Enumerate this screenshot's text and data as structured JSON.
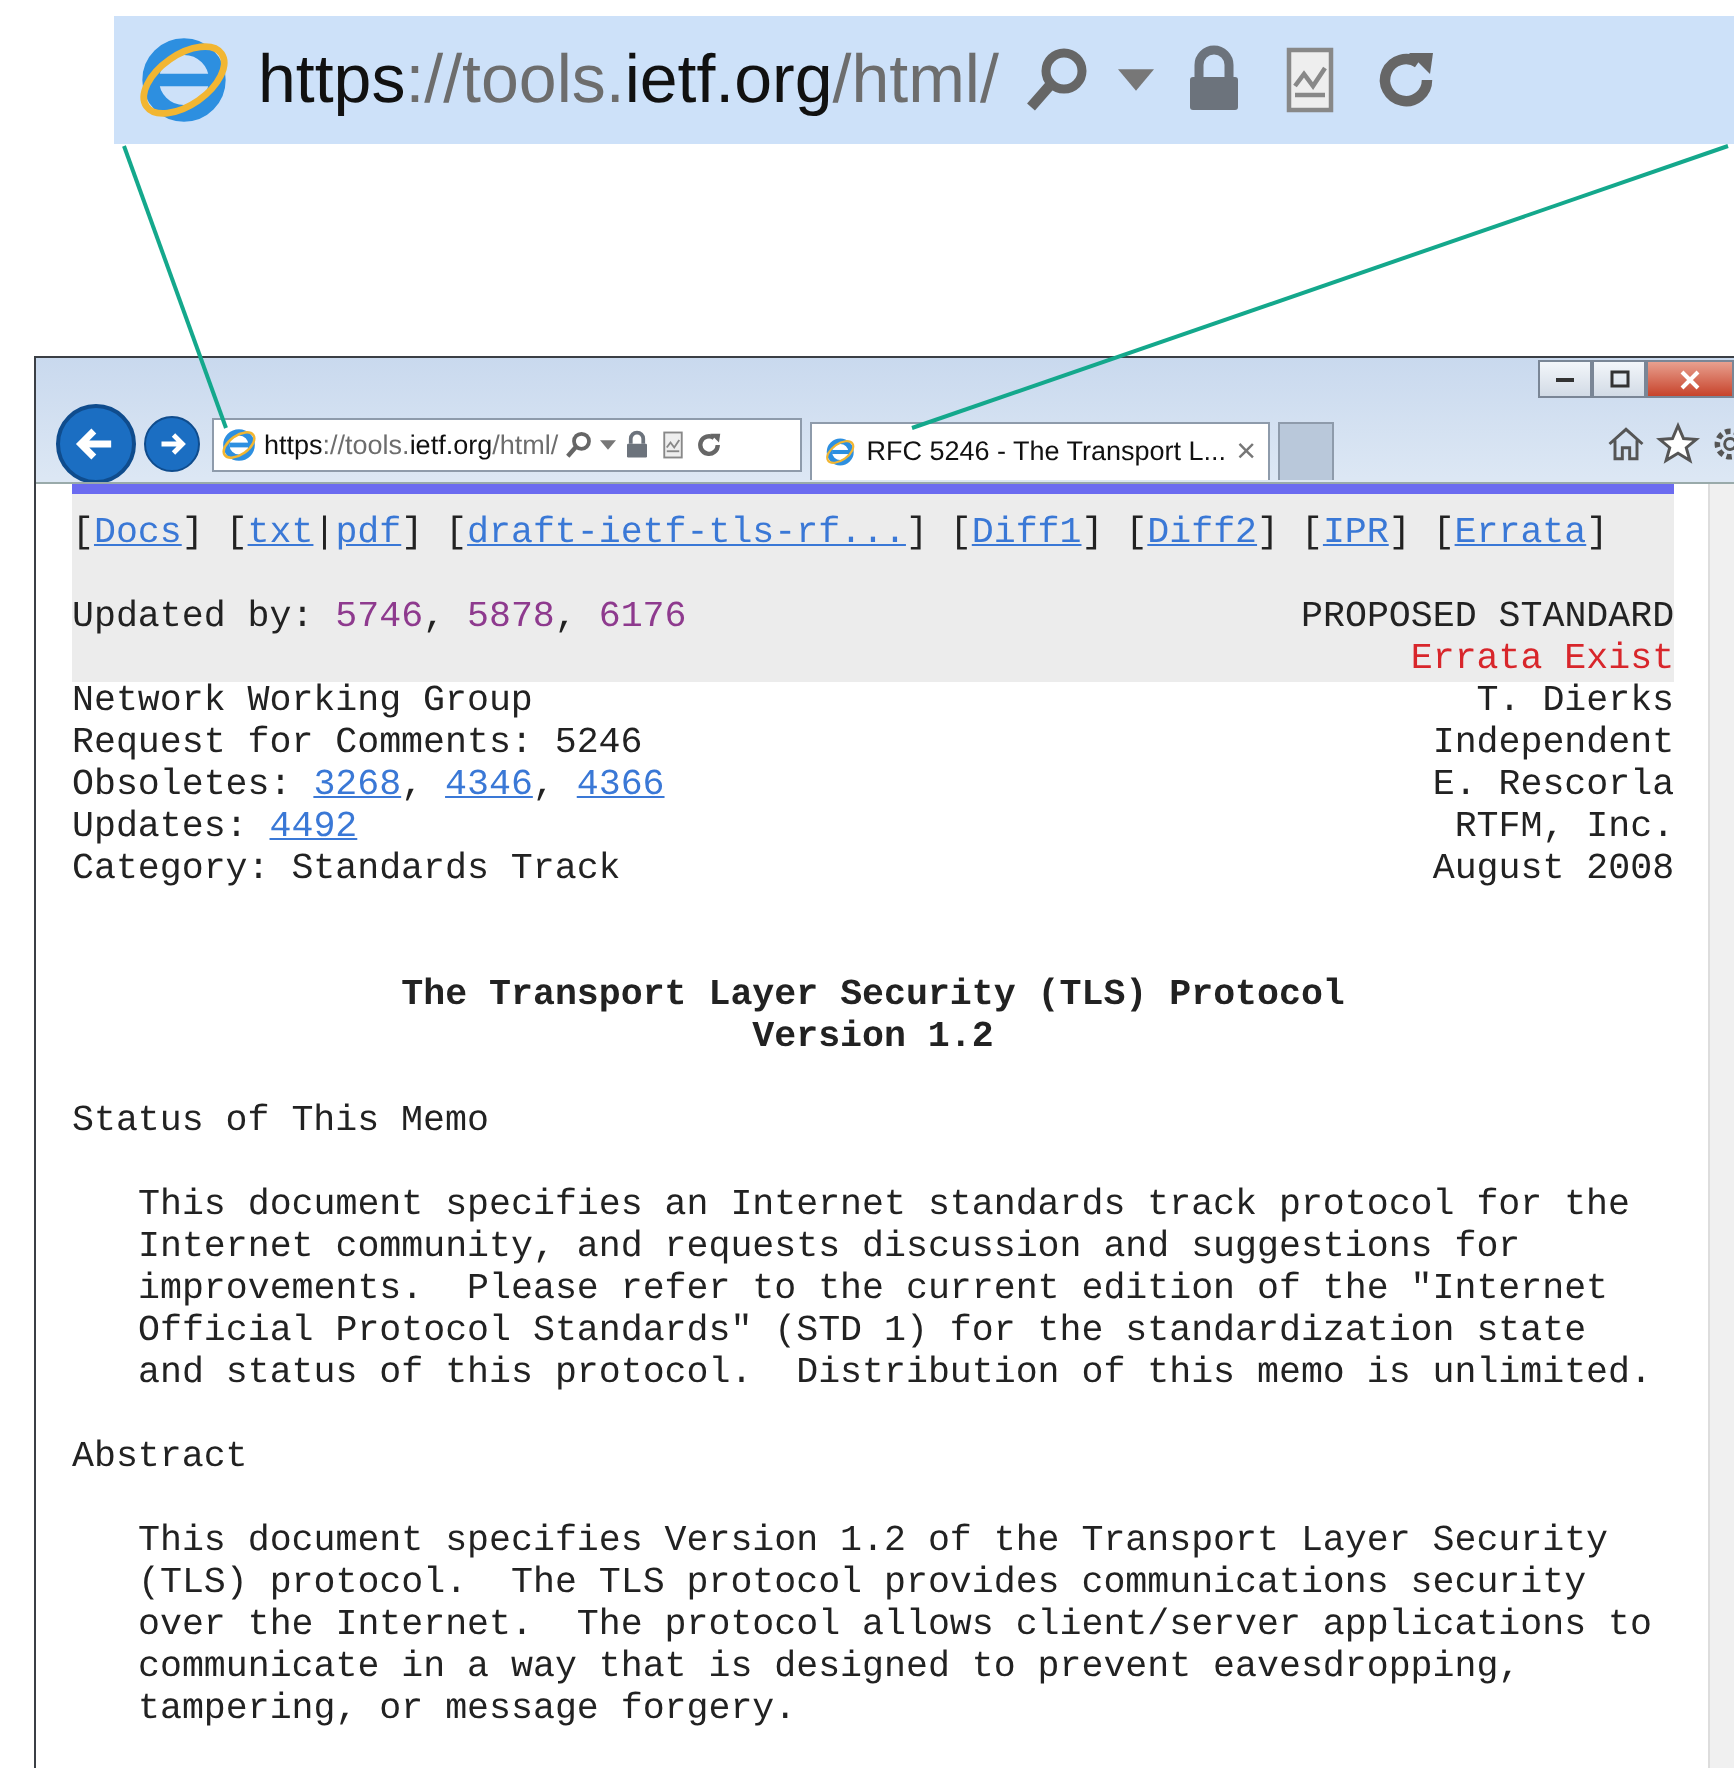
{
  "callout": {
    "url": [
      {
        "text": "https",
        "strong": true
      },
      {
        "text": "://tools.",
        "strong": false
      },
      {
        "text": "ietf.org",
        "strong": true
      },
      {
        "text": "/html/",
        "strong": false
      }
    ]
  },
  "browser": {
    "url": [
      {
        "text": "https",
        "strong": true
      },
      {
        "text": "://tools.",
        "strong": false
      },
      {
        "text": "ietf.org",
        "strong": true
      },
      {
        "text": "/html/",
        "strong": false
      }
    ],
    "tabs": [
      {
        "title": "RFC 5246 - The Transport L...",
        "close": "×",
        "selected": true
      },
      {
        "selected": false
      }
    ]
  },
  "doc": {
    "nav": [
      {
        "text": "[",
        "link": false
      },
      {
        "text": "Docs",
        "link": true
      },
      {
        "text": "] [",
        "link": false
      },
      {
        "text": "txt",
        "link": true
      },
      {
        "text": "|",
        "link": false
      },
      {
        "text": "pdf",
        "link": true
      },
      {
        "text": "] [",
        "link": false
      },
      {
        "text": "draft-ietf-tls-rf...",
        "link": true
      },
      {
        "text": "] [",
        "link": false
      },
      {
        "text": "Diff1",
        "link": true
      },
      {
        "text": "] [",
        "link": false
      },
      {
        "text": "Diff2",
        "link": true
      },
      {
        "text": "] [",
        "link": false
      },
      {
        "text": "IPR",
        "link": true
      },
      {
        "text": "] [",
        "link": false
      },
      {
        "text": "Errata",
        "link": true
      },
      {
        "text": "]",
        "link": false
      }
    ],
    "updated_by": {
      "line": [
        {
          "text": "Updated by: ",
          "link": false
        },
        {
          "text": "5746",
          "link": true
        },
        {
          "text": ", ",
          "link": false
        },
        {
          "text": "5878",
          "link": true
        },
        {
          "text": ", ",
          "link": false
        },
        {
          "text": "6176",
          "link": true
        }
      ],
      "status": "PROPOSED STANDARD",
      "errata": "Errata Exist"
    },
    "header": [
      {
        "left": [
          {
            "text": "Network Working Group",
            "link": false
          }
        ],
        "right": "T. Dierks"
      },
      {
        "left": [
          {
            "text": "Request for Comments: 5246",
            "link": false
          }
        ],
        "right": "Independent"
      },
      {
        "left": [
          {
            "text": "Obsoletes: ",
            "link": false
          },
          {
            "text": "3268",
            "link": true
          },
          {
            "text": ", ",
            "link": false
          },
          {
            "text": "4346",
            "link": true
          },
          {
            "text": ", ",
            "link": false
          },
          {
            "text": "4366",
            "link": true
          }
        ],
        "right": "E. Rescorla"
      },
      {
        "left": [
          {
            "text": "Updates: ",
            "link": false
          },
          {
            "text": "4492",
            "link": true
          }
        ],
        "right": "RTFM, Inc."
      },
      {
        "left": [
          {
            "text": "Category: Standards Track",
            "link": false
          }
        ],
        "right": "August 2008"
      }
    ],
    "title": [
      "The Transport Layer Security (TLS) Protocol",
      "Version 1.2"
    ],
    "sections": [
      {
        "heading": "Status of This Memo",
        "paragraph": "This document specifies an Internet standards track protocol for the\nInternet community, and requests discussion and suggestions for\nimprovements.  Please refer to the current edition of the \"Internet\nOfficial Protocol Standards\" (STD 1) for the standardization state\nand status of this protocol.  Distribution of this memo is unlimited."
      },
      {
        "heading": "Abstract",
        "paragraph": "This document specifies Version 1.2 of the Transport Layer Security\n(TLS) protocol.  The TLS protocol provides communications security\nover the Internet.  The protocol allows client/server applications to\ncommunicate in a way that is designed to prevent eavesdropping,\ntampering, or message forgery."
      }
    ]
  }
}
